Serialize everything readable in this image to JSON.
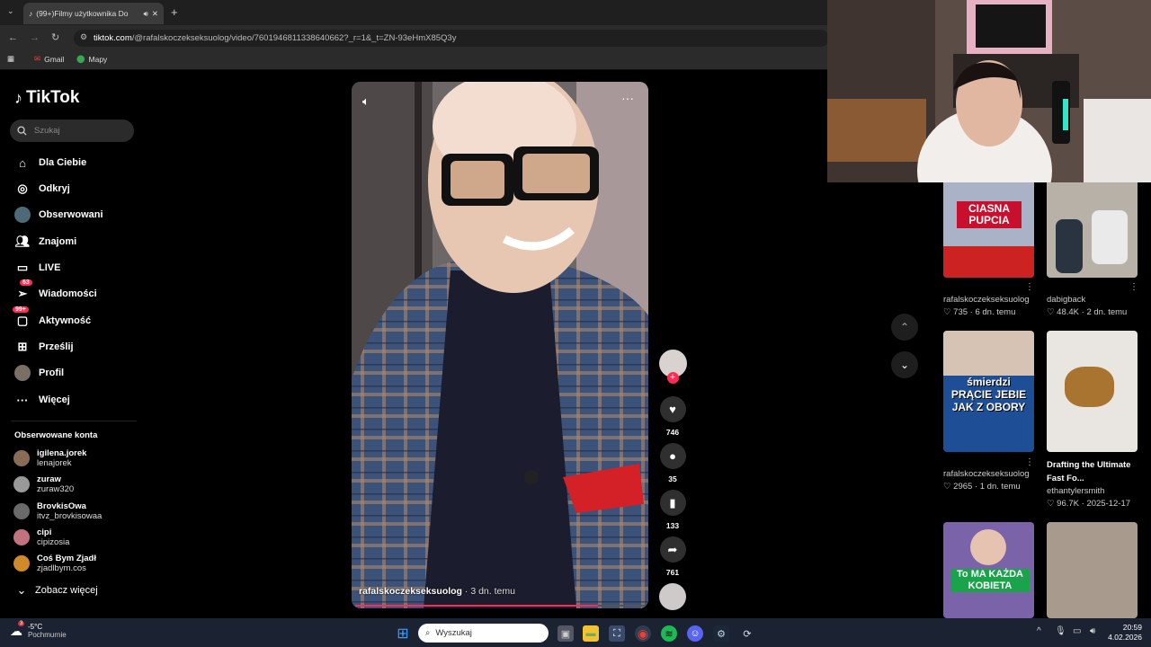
{
  "browser": {
    "tab_title": "(99+)Filmy użytkownika Do",
    "url_host": "tiktok.com",
    "url_path": "/@rafalskoczekseksuolog/video/7601946811338640662?_r=1&_t=ZN-93eHmX85Q3y",
    "bookmarks": [
      {
        "label": "Gmail"
      },
      {
        "label": "Mapy"
      }
    ]
  },
  "app": {
    "logo": "TikTok"
  },
  "search": {
    "placeholder": "Szukaj"
  },
  "nav": [
    {
      "label": "Dla Ciebie",
      "icon": "home-icon"
    },
    {
      "label": "Odkryj",
      "icon": "compass-icon"
    },
    {
      "label": "Obserwowani",
      "icon": "avatar-icon"
    },
    {
      "label": "Znajomi",
      "icon": "friends-icon"
    },
    {
      "label": "LIVE",
      "icon": "live-icon"
    },
    {
      "label": "Wiadomości",
      "icon": "messages-icon",
      "badge": "63"
    },
    {
      "label": "Aktywność",
      "icon": "activity-icon",
      "badge": "99+"
    },
    {
      "label": "Prześlij",
      "icon": "upload-icon"
    },
    {
      "label": "Profil",
      "icon": "profile-icon"
    },
    {
      "label": "Więcej",
      "icon": "more-icon"
    }
  ],
  "followed": {
    "title": "Obserwowane konta",
    "accounts": [
      {
        "name": "igilena.jorek",
        "handle": "lenajorek"
      },
      {
        "name": "zuraw",
        "handle": "zuraw320"
      },
      {
        "name": "BrovkisOwa",
        "handle": "itvz_brovkisowaa"
      },
      {
        "name": "cipi",
        "handle": "cipizosia"
      },
      {
        "name": "Coś Bym Zjadł",
        "handle": "zjadlbym.cos"
      }
    ],
    "see_more": "Zobacz więcej"
  },
  "video": {
    "author": "rafalskoczekseksuolog",
    "age": "· 3 dn. temu",
    "likes": "746",
    "comments": "35",
    "saves": "133",
    "shares": "761"
  },
  "grid": [
    {
      "author": "rafalskoczekseksuolog",
      "likes": "735",
      "age": "6 dn. temu",
      "overlay": "CIASNA PUPCIA"
    },
    {
      "author": "dabigback",
      "likes": "48.4K",
      "age": "2 dn. temu"
    },
    {
      "author": "rafalskoczekseksuolog",
      "likes": "2965",
      "age": "1 dn. temu",
      "overlay": "śmierdzi PRĄCIE JEBIE JAK Z OBORY"
    },
    {
      "title": "Drafting the Ultimate Fast Fo...",
      "author": "ethantylersmith",
      "likes": "96.7K",
      "age": "2025-12-17"
    },
    {
      "overlay": "To MA KAŻDA KOBIETA"
    },
    {}
  ],
  "taskbar": {
    "weather_temp": "-5°C",
    "weather_desc": "Pochmurnie",
    "search": "Wyszukaj",
    "time": "20:59",
    "date": "4.02.2026",
    "weather_badge": "3"
  },
  "colors": {
    "accent": "#fe2c55",
    "bg": "#000000",
    "taskbar": "#1b2231"
  }
}
